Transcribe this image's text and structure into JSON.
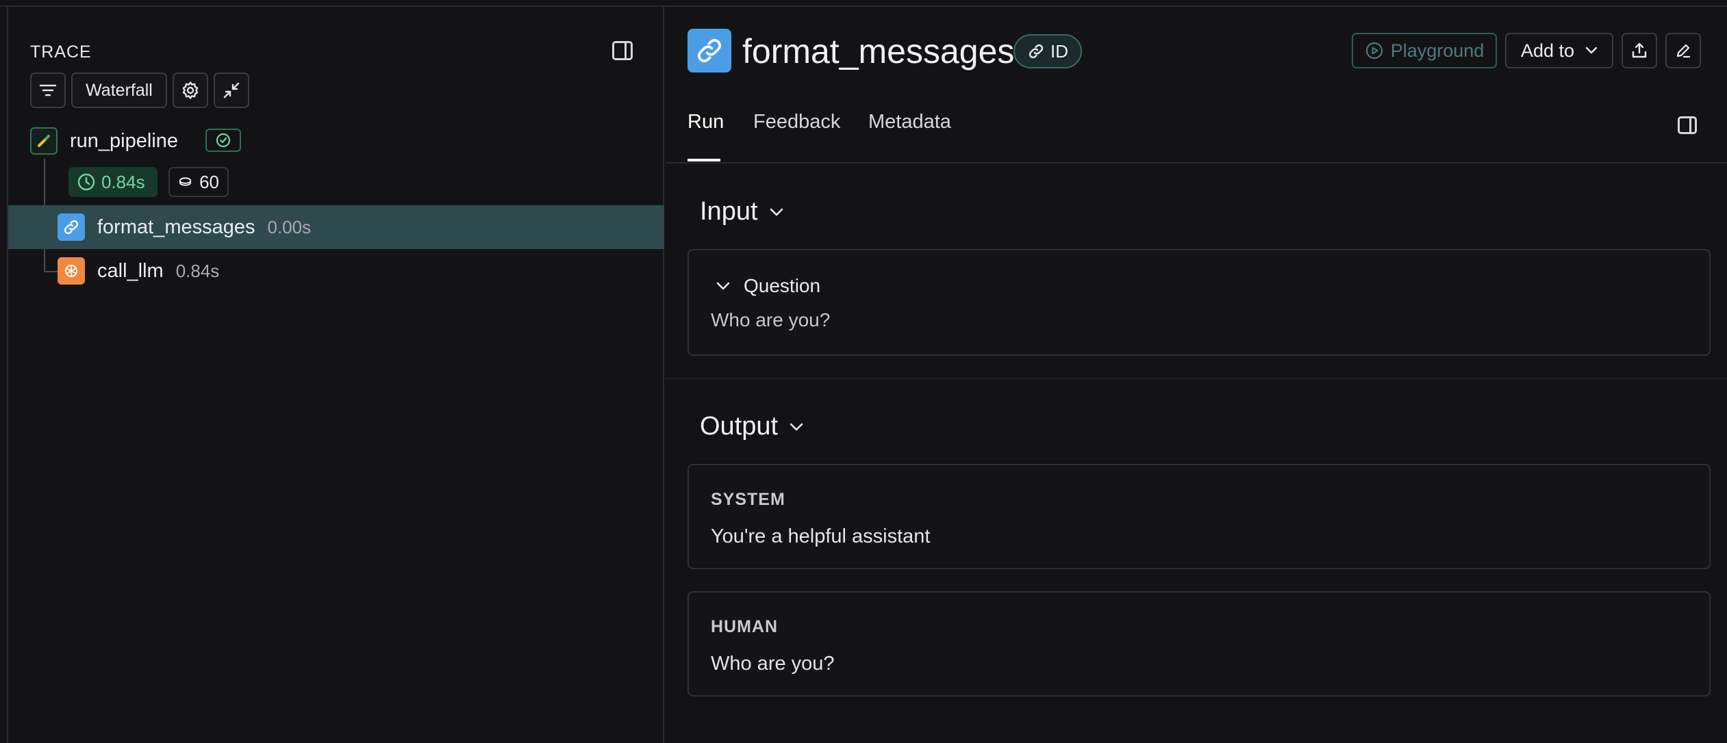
{
  "trace_panel": {
    "title": "TRACE",
    "view_mode": "Waterfall",
    "root": {
      "name": "run_pipeline",
      "status": "success",
      "latency": "0.84s",
      "tokens": "60"
    },
    "children": [
      {
        "name": "format_messages",
        "time": "0.00s",
        "icon": "link-icon",
        "selected": true
      },
      {
        "name": "call_llm",
        "time": "0.84s",
        "icon": "llm-icon",
        "selected": false
      }
    ]
  },
  "run_header": {
    "title": "format_messages",
    "id_label": "ID",
    "playground_label": "Playground",
    "add_to_label": "Add to"
  },
  "tabs": [
    {
      "label": "Run",
      "active": true
    },
    {
      "label": "Feedback",
      "active": false
    },
    {
      "label": "Metadata",
      "active": false
    }
  ],
  "input": {
    "section_label": "Input",
    "field_label": "Question",
    "field_value": "Who are you?"
  },
  "output": {
    "section_label": "Output",
    "messages": [
      {
        "role": "SYSTEM",
        "content": "You're a helpful assistant"
      },
      {
        "role": "HUMAN",
        "content": "Who are you?"
      }
    ]
  },
  "colors": {
    "background": "#131316",
    "accent_blue": "#4b9ee6",
    "accent_orange": "#f0883e",
    "success_green": "#6fd7a3",
    "selected_row": "#2e4a4d"
  }
}
